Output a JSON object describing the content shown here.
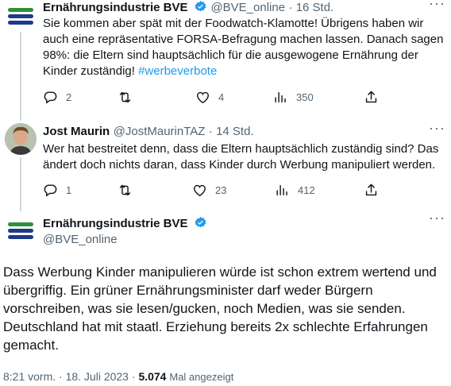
{
  "tweets": [
    {
      "author": "Ernährungsindustrie BVE",
      "handle": "@BVE_online",
      "time": "16 Std.",
      "text_main": "Sie kommen aber spät mit der Foodwatch-Klamotte! Übrigens haben wir auch eine repräsentative FORSA-Befragung machen lassen. Danach sagen 98%: die Eltern sind hauptsächlich für die ausgewogene Ernährung der Kinder zuständig!",
      "hashtag": "#werbeverbote",
      "replies": "2",
      "retweets": "",
      "likes": "4",
      "views": "350"
    },
    {
      "author": "Jost Maurin",
      "handle": "@JostMaurinTAZ",
      "time": "14 Std.",
      "text_main": "Wer hat bestreitet denn, dass die Eltern hauptsächlich zuständig sind? Das ändert doch nichts daran, dass Kinder durch Werbung manipuliert werden.",
      "replies": "1",
      "retweets": "",
      "likes": "23",
      "views": "412"
    }
  ],
  "main_tweet": {
    "author": "Ernährungsindustrie BVE",
    "handle": "@BVE_online",
    "text": "Dass Werbung Kinder manipulieren würde ist schon extrem wertend und übergriffig. Ein grüner Ernährungsminister darf weder Bürgern vorschreiben, was sie lesen/gucken, noch Medien, was sie senden. Deutschland hat mit staatl. Erziehung bereits 2x schlechte Erfahrungen gemacht.",
    "timestamp": "8:21 vorm. · 18. Juli 2023",
    "views_count": "5.074",
    "views_label": "Mal angezeigt"
  },
  "colors": {
    "verified": "#1d9bf0",
    "bve_green": "#2f8f3a",
    "bve_blue": "#1e3a8a",
    "text_secondary": "#536471"
  },
  "icons": {
    "reply": "reply-icon",
    "retweet": "retweet-icon",
    "like": "heart-icon",
    "views": "views-icon",
    "share": "share-icon",
    "more": "more-icon",
    "verified": "verified-badge-icon"
  }
}
